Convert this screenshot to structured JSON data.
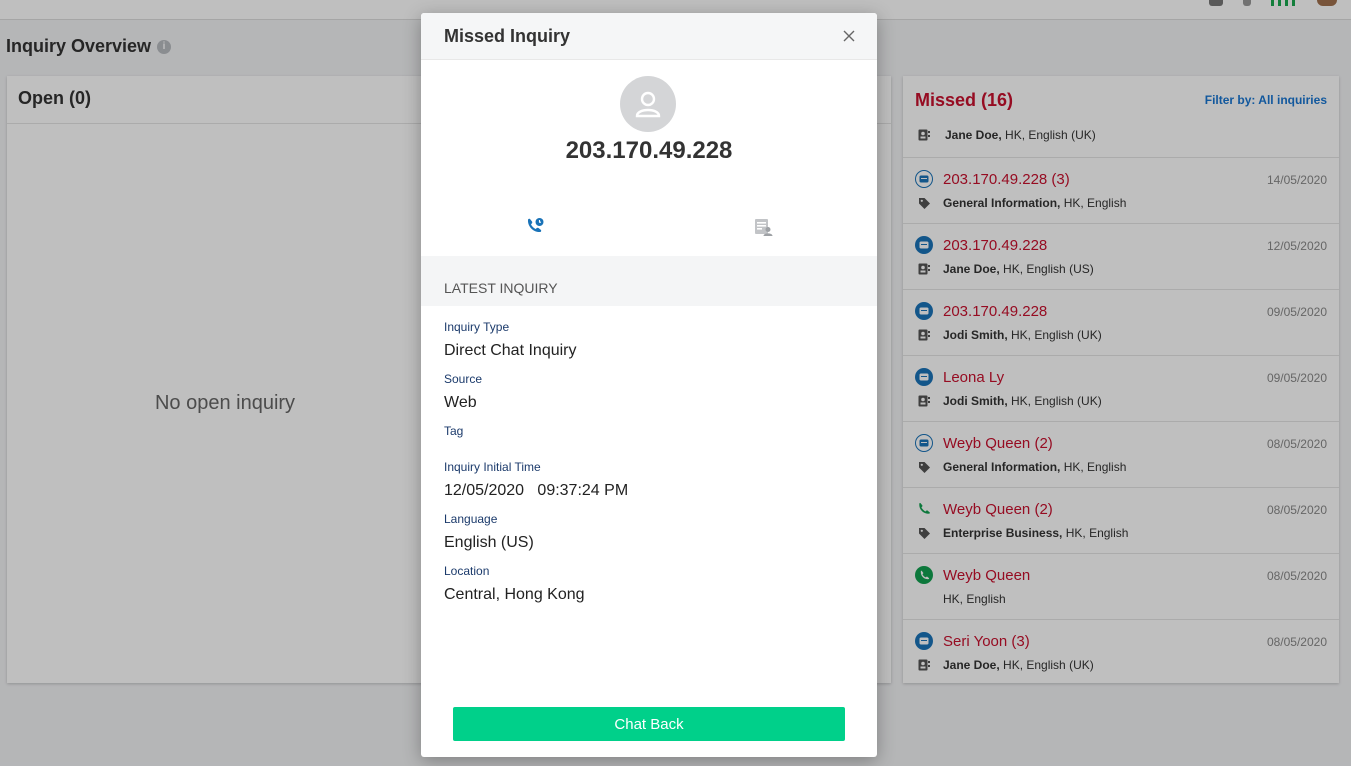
{
  "page": {
    "title": "Inquiry Overview"
  },
  "open_panel": {
    "title": "Open (0)",
    "empty_text": "No open inquiry"
  },
  "missed_panel": {
    "title": "Missed (16)",
    "filter": "Filter by: All inquiries",
    "partial_row": {
      "bold": "Jane Doe,",
      "rest": " HK, English (UK)",
      "sub_icon": "contact-card-icon"
    },
    "rows": [
      {
        "name": "203.170.49.228 (3)",
        "date": "14/05/2020",
        "channel": "chat-outline",
        "sub_icon": "tag-icon",
        "bold": "General Information,",
        "rest": " HK, English"
      },
      {
        "name": "203.170.49.228",
        "date": "12/05/2020",
        "channel": "chat",
        "sub_icon": "contact-card-icon",
        "bold": "Jane Doe,",
        "rest": " HK, English (US)"
      },
      {
        "name": "203.170.49.228",
        "date": "09/05/2020",
        "channel": "chat",
        "sub_icon": "contact-card-icon",
        "bold": "Jodi Smith,",
        "rest": " HK, English (UK)"
      },
      {
        "name": "Leona Ly",
        "date": "09/05/2020",
        "channel": "chat",
        "sub_icon": "contact-card-icon",
        "bold": "Jodi Smith,",
        "rest": " HK, English (UK)"
      },
      {
        "name": "Weyb Queen (2)",
        "date": "08/05/2020",
        "channel": "chat-outline",
        "sub_icon": "tag-icon",
        "bold": "General Information,",
        "rest": " HK, English"
      },
      {
        "name": "Weyb Queen (2)",
        "date": "08/05/2020",
        "channel": "phone-outline",
        "sub_icon": "tag-icon",
        "bold": "Enterprise Business,",
        "rest": " HK, English"
      },
      {
        "name": "Weyb Queen",
        "date": "08/05/2020",
        "channel": "phone",
        "sub_icon": "",
        "bold": "",
        "rest": "HK, English"
      },
      {
        "name": "Seri Yoon (3)",
        "date": "08/05/2020",
        "channel": "chat",
        "sub_icon": "contact-card-icon",
        "bold": "Jane Doe,",
        "rest": " HK, English (UK)"
      }
    ]
  },
  "modal": {
    "title": "Missed Inquiry",
    "contact": "203.170.49.228",
    "section": "LATEST INQUIRY",
    "fields": {
      "inquiry_type_label": "Inquiry Type",
      "inquiry_type": "Direct Chat Inquiry",
      "source_label": "Source",
      "source": "Web",
      "tag_label": "Tag",
      "tag": "",
      "initial_time_label": "Inquiry Initial Time",
      "initial_time": "12/05/2020   09:37:24 PM",
      "language_label": "Language",
      "language": "English (US)",
      "location_label": "Location",
      "location": "Central, Hong Kong"
    },
    "chat_back": "Chat Back"
  },
  "colors": {
    "missed_red": "#c8102e",
    "filter_blue": "#1976d2",
    "chat_back_green": "#00d08a",
    "label_navy": "#1b3a6b",
    "active_tab_blue": "#1a73b8"
  }
}
